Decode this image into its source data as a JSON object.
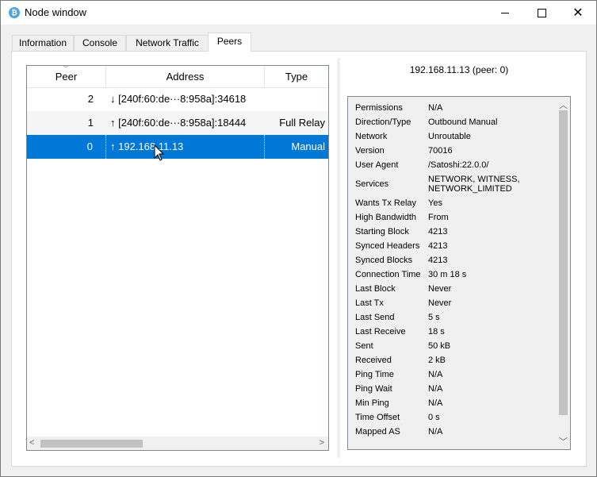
{
  "window": {
    "title": "Node window",
    "app_icon": "bitcoin-icon"
  },
  "tabs": [
    {
      "label": "Information",
      "active": false
    },
    {
      "label": "Console",
      "active": false
    },
    {
      "label": "Network Traffic",
      "active": false
    },
    {
      "label": "Peers",
      "active": true
    }
  ],
  "peers_table": {
    "columns": [
      "Peer",
      "Address",
      "Type"
    ],
    "rows": [
      {
        "peer": "2",
        "address": "↓ [240f:60:de···8:958a]:34618",
        "type": ""
      },
      {
        "peer": "1",
        "address": "↑ [240f:60:de···8:958a]:18444",
        "type": "Full Relay"
      },
      {
        "peer": "0",
        "address": "↑ 192.168.11.13",
        "type": "Manual"
      }
    ]
  },
  "peer_detail": {
    "heading": "192.168.11.13 (peer: 0)",
    "fields": [
      {
        "label": "Permissions",
        "value": "N/A"
      },
      {
        "label": "Direction/Type",
        "value": "Outbound Manual"
      },
      {
        "label": "Network",
        "value": "Unroutable"
      },
      {
        "label": "Version",
        "value": "70016"
      },
      {
        "label": "User Agent",
        "value": "/Satoshi:22.0.0/"
      },
      {
        "label": "Services",
        "value": "NETWORK, WITNESS,",
        "value2": "NETWORK_LIMITED"
      },
      {
        "label": "Wants Tx Relay",
        "value": "Yes"
      },
      {
        "label": "High Bandwidth",
        "value": "From"
      },
      {
        "label": "Starting Block",
        "value": "4213"
      },
      {
        "label": "Synced Headers",
        "value": "4213"
      },
      {
        "label": "Synced Blocks",
        "value": "4213"
      },
      {
        "label": "Connection Time",
        "value": "30 m 18 s"
      },
      {
        "label": "Last Block",
        "value": "Never"
      },
      {
        "label": "Last Tx",
        "value": "Never"
      },
      {
        "label": "Last Send",
        "value": "5 s"
      },
      {
        "label": "Last Receive",
        "value": "18 s"
      },
      {
        "label": "Sent",
        "value": "50 kB"
      },
      {
        "label": "Received",
        "value": "2 kB"
      },
      {
        "label": "Ping Time",
        "value": "N/A"
      },
      {
        "label": "Ping Wait",
        "value": "N/A"
      },
      {
        "label": "Min Ping",
        "value": "N/A"
      },
      {
        "label": "Time Offset",
        "value": "0 s"
      },
      {
        "label": "Mapped AS",
        "value": "N/A"
      }
    ]
  },
  "colors": {
    "selection": "#0078d7",
    "app_icon": "#4fa3e0"
  }
}
